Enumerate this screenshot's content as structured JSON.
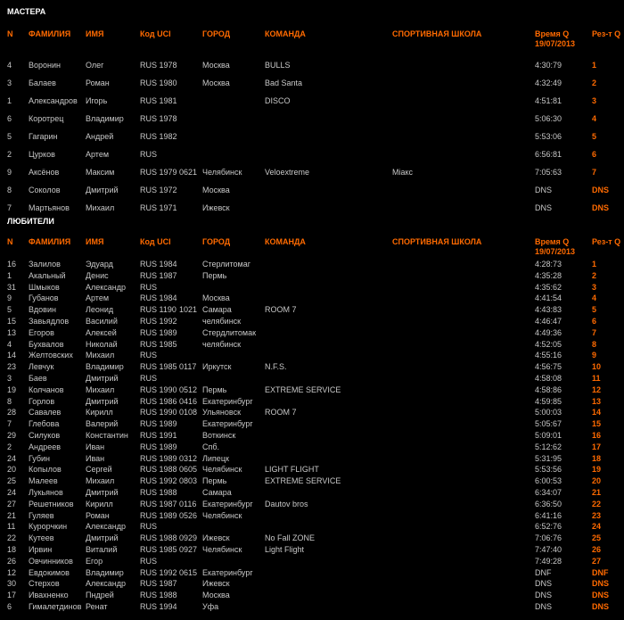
{
  "columns": {
    "n": "N",
    "surname": "ФАМИЛИЯ",
    "name": "ИМЯ",
    "uci": "Код UCI",
    "city": "ГОРОД",
    "team": "КОМАНДА",
    "school": "СПОРТИВНАЯ ШКОЛА",
    "time_line1": "Время Q",
    "time_line2": "19/07/2013",
    "result": "Рез-т Q"
  },
  "masters": {
    "title": "МАСТЕРА",
    "rows": [
      {
        "n": "4",
        "surname": "Воронин",
        "name": "Олег",
        "uci": "RUS 1978",
        "code": "",
        "city": "Москва",
        "team": "BULLS",
        "school": "",
        "time": "4:30:79",
        "result": "1"
      },
      {
        "n": "3",
        "surname": "Балаев",
        "name": "Роман",
        "uci": "RUS 1980",
        "code": "",
        "city": "Москва",
        "team": "Bad Santa",
        "school": "",
        "time": "4:32:49",
        "result": "2"
      },
      {
        "n": "1",
        "surname": "Александров",
        "name": "Игорь",
        "uci": "RUS 1981",
        "code": "",
        "city": "",
        "team": "DISCO",
        "school": "",
        "time": "4:51:81",
        "result": "3"
      },
      {
        "n": "6",
        "surname": "Коротрец",
        "name": "Владимир",
        "uci": "RUS 1978",
        "code": "",
        "city": "",
        "team": "",
        "school": "",
        "time": "5:06:30",
        "result": "4"
      },
      {
        "n": "5",
        "surname": "Гагарин",
        "name": "Андрей",
        "uci": "RUS 1982",
        "code": "",
        "city": "",
        "team": "",
        "school": "",
        "time": "5:53:06",
        "result": "5"
      },
      {
        "n": "2",
        "surname": "Цурков",
        "name": "Артем",
        "uci": "RUS",
        "code": "",
        "city": "",
        "team": "",
        "school": "",
        "time": "6:56:81",
        "result": "6"
      },
      {
        "n": "9",
        "surname": "Аксёнов",
        "name": "Максим",
        "uci": "RUS 1979",
        "code": "0621",
        "city": "Челябинск",
        "team": "Veloextreme",
        "school": "Miaкс",
        "time": "7:05:63",
        "result": "7"
      },
      {
        "n": "8",
        "surname": "Соколов",
        "name": "Дмитрий",
        "uci": "RUS 1972",
        "code": "",
        "city": "Москва",
        "team": "",
        "school": "",
        "time": "DNS",
        "result": "DNS"
      },
      {
        "n": "7",
        "surname": "Мартьянов",
        "name": "Михаил",
        "uci": "RUS 1971",
        "code": "",
        "city": "Ижевск",
        "team": "",
        "school": "",
        "time": "DNS",
        "result": "DNS"
      }
    ]
  },
  "amateurs": {
    "title": "ЛЮБИТЕЛИ",
    "rows": [
      {
        "n": "16",
        "surname": "Залилов",
        "name": "Эдуард",
        "uci": "RUS 1984",
        "code": "",
        "city": "Стерлитомаг",
        "team": "",
        "school": "",
        "time": "4:28:73",
        "result": "1"
      },
      {
        "n": "1",
        "surname": "Акальный",
        "name": "Денис",
        "uci": "RUS 1987",
        "code": "",
        "city": "Пермь",
        "team": "",
        "school": "",
        "time": "4:35:28",
        "result": "2"
      },
      {
        "n": "31",
        "surname": "Шмыков",
        "name": "Александр",
        "uci": "RUS",
        "code": "",
        "city": "",
        "team": "",
        "school": "",
        "time": "4:35:62",
        "result": "3"
      },
      {
        "n": "9",
        "surname": "Губанов",
        "name": "Артем",
        "uci": "RUS 1984",
        "code": "",
        "city": "Москва",
        "team": "",
        "school": "",
        "time": "4:41:54",
        "result": "4"
      },
      {
        "n": "5",
        "surname": "Вдовин",
        "name": "Леонид",
        "uci": "RUS 1190",
        "code": "1021",
        "city": "Самара",
        "team": "ROOM 7",
        "school": "",
        "time": "4:43:83",
        "result": "5"
      },
      {
        "n": "15",
        "surname": "Завьядлов",
        "name": "Василий",
        "uci": "RUS 1992",
        "code": "",
        "city": "челябинск",
        "team": "",
        "school": "",
        "time": "4:46:47",
        "result": "6"
      },
      {
        "n": "13",
        "surname": "Егоров",
        "name": "Алексей",
        "uci": "RUS 1989",
        "code": "",
        "city": "Стердлитомак",
        "team": "",
        "school": "",
        "time": "4:49:36",
        "result": "7"
      },
      {
        "n": "4",
        "surname": "Бухвалов",
        "name": "Николай",
        "uci": "RUS 1985",
        "code": "",
        "city": "челябинск",
        "team": "",
        "school": "",
        "time": "4:52:05",
        "result": "8"
      },
      {
        "n": "14",
        "surname": "Желтовских",
        "name": "Михаил",
        "uci": "RUS",
        "code": "",
        "city": "",
        "team": "",
        "school": "",
        "time": "4:55:16",
        "result": "9"
      },
      {
        "n": "23",
        "surname": "Левчук",
        "name": "Владимир",
        "uci": "RUS 1985",
        "code": "0117",
        "city": "Иркутск",
        "team": "N.F.S.",
        "school": "",
        "time": "4:56:75",
        "result": "10"
      },
      {
        "n": "3",
        "surname": "Баев",
        "name": "Дмитрий",
        "uci": "RUS",
        "code": "",
        "city": "",
        "team": "",
        "school": "",
        "time": "4:58:08",
        "result": "11"
      },
      {
        "n": "19",
        "surname": "Колчанов",
        "name": "Михаил",
        "uci": "RUS 1990",
        "code": "0512",
        "city": "Пермь",
        "team": "EXTREME SERVICE",
        "school": "",
        "time": "4:58:86",
        "result": "12"
      },
      {
        "n": "8",
        "surname": "Горлов",
        "name": "Дмитрий",
        "uci": "RUS 1986",
        "code": "0416",
        "city": "Екатеринбург",
        "team": "",
        "school": "",
        "time": "4:59:85",
        "result": "13"
      },
      {
        "n": "28",
        "surname": "Савалев",
        "name": "Кирилл",
        "uci": "RUS 1990",
        "code": "0108",
        "city": "Ульяновск",
        "team": "ROOM 7",
        "school": "",
        "time": "5:00:03",
        "result": "14"
      },
      {
        "n": "7",
        "surname": "Глебова",
        "name": "Валерий",
        "uci": "RUS 1989",
        "code": "",
        "city": "Екатеринбург",
        "team": "",
        "school": "",
        "time": "5:05:67",
        "result": "15"
      },
      {
        "n": "29",
        "surname": "Силуков",
        "name": "Константин",
        "uci": "RUS 1991",
        "code": "",
        "city": "Воткинск",
        "team": "",
        "school": "",
        "time": "5:09:01",
        "result": "16"
      },
      {
        "n": "2",
        "surname": "Андреев",
        "name": "Иван",
        "uci": "RUS 1989",
        "code": "",
        "city": "Спб.",
        "team": "",
        "school": "",
        "time": "5:12:62",
        "result": "17"
      },
      {
        "n": "24",
        "surname": "Губин",
        "name": "Иван",
        "uci": "RUS 1989",
        "code": "0312",
        "city": "Липецк",
        "team": "",
        "school": "",
        "time": "5:31:95",
        "result": "18"
      },
      {
        "n": "20",
        "surname": "Копылов",
        "name": "Сергей",
        "uci": "RUS 1988",
        "code": "0605",
        "city": "Челябинск",
        "team": "LIGHT FLIGHT",
        "school": "",
        "time": "5:53:56",
        "result": "19"
      },
      {
        "n": "25",
        "surname": "Малеев",
        "name": "Михаил",
        "uci": "RUS 1992",
        "code": "0803",
        "city": "Пермь",
        "team": "EXTREME SERVICE",
        "school": "",
        "time": "6:00:53",
        "result": "20"
      },
      {
        "n": "24",
        "surname": "Лукьянов",
        "name": "Дмитрий",
        "uci": "RUS 1988",
        "code": "",
        "city": "Самара",
        "team": "",
        "school": "",
        "time": "6:34:07",
        "result": "21"
      },
      {
        "n": "27",
        "surname": "Решетников",
        "name": "Кирилл",
        "uci": "RUS 1987",
        "code": "0116",
        "city": "Екатеринбург",
        "team": "Dautov bros",
        "school": "",
        "time": "6:36:50",
        "result": "22"
      },
      {
        "n": "21",
        "surname": "Гуляев",
        "name": "Роман",
        "uci": "RUS 1989",
        "code": "0526",
        "city": "Челябинск",
        "team": "",
        "school": "",
        "time": "6:41:16",
        "result": "23"
      },
      {
        "n": "11",
        "surname": "Курорчкин",
        "name": "Александр",
        "uci": "RUS",
        "code": "",
        "city": "",
        "team": "",
        "school": "",
        "time": "6:52:76",
        "result": "24"
      },
      {
        "n": "22",
        "surname": "Кутеев",
        "name": "Дмитрий",
        "uci": "RUS 1988",
        "code": "0929",
        "city": "Ижевск",
        "team": "No Fall ZONE",
        "school": "",
        "time": "7:06:76",
        "result": "25"
      },
      {
        "n": "18",
        "surname": "Ирвин",
        "name": "Виталий",
        "uci": "RUS 1985",
        "code": "0927",
        "city": "Челябинск",
        "team": "Light Flight",
        "school": "",
        "time": "7:47:40",
        "result": "26"
      },
      {
        "n": "26",
        "surname": "Овчинников",
        "name": "Егор",
        "uci": "RUS",
        "code": "",
        "city": "",
        "team": "",
        "school": "",
        "time": "7:49:28",
        "result": "27"
      },
      {
        "n": "12",
        "surname": "Евдокимов",
        "name": "Владимир",
        "uci": "RUS 1992",
        "code": "0615",
        "city": "Екатеринбург",
        "team": "",
        "school": "",
        "time": "DNF",
        "result": "DNF"
      },
      {
        "n": "30",
        "surname": "Стерхов",
        "name": "Александр",
        "uci": "RUS 1987",
        "code": "",
        "city": "Ижевск",
        "team": "",
        "school": "",
        "time": "DNS",
        "result": "DNS"
      },
      {
        "n": "17",
        "surname": "Иваxненко",
        "name": "Пндрей",
        "uci": "RUS 1988",
        "code": "",
        "city": "Москва",
        "team": "",
        "school": "",
        "time": "DNS",
        "result": "DNS"
      },
      {
        "n": "6",
        "surname": "Гималетдинов",
        "name": "Ренат",
        "uci": "RUS 1994",
        "code": "",
        "city": "Уфа",
        "team": "",
        "school": "",
        "time": "DNS",
        "result": "DNS"
      }
    ]
  },
  "colors": {
    "background": "#000000",
    "header_accent": "#ff6a00",
    "text": "#c8c8c8",
    "section_title": "#ffffff"
  }
}
